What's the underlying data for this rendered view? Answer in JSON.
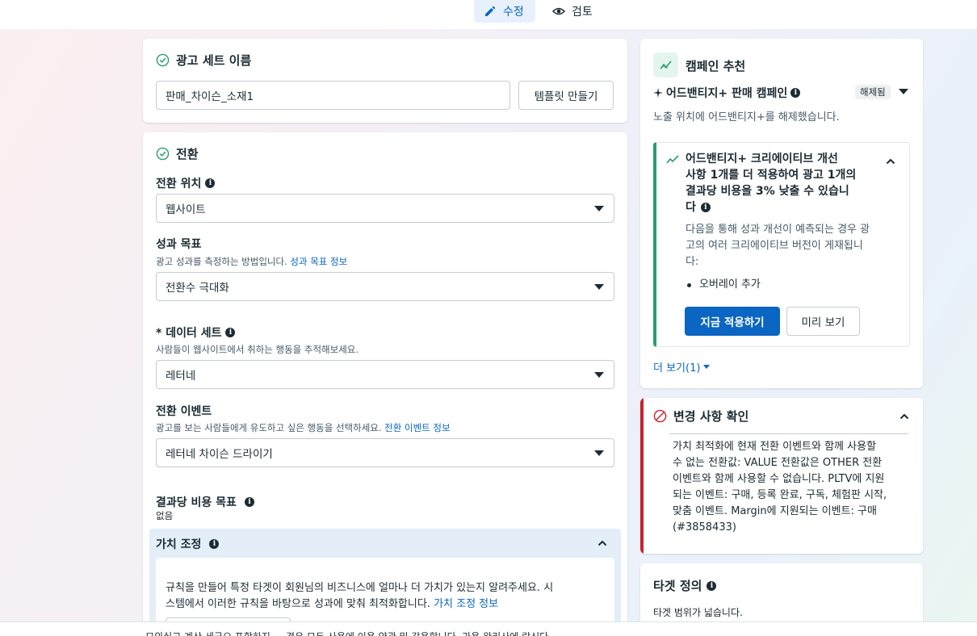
{
  "tabs": {
    "edit": "수정",
    "review": "검토"
  },
  "adset_name": {
    "title": "광고 세트 이름",
    "value": "판매_차이슨_소재1",
    "template_button": "템플릿 만들기"
  },
  "conversion": {
    "title": "전환",
    "location_label": "전환 위치",
    "location_value": "웹사이트",
    "goal_label": "성과 목표",
    "goal_desc": "광고 성과를 측정하는 방법입니다.",
    "goal_link": "성과 목표 정보",
    "goal_value": "전환수 극대화",
    "dataset_label": "* 데이터 세트",
    "dataset_desc": "사람들이 웹사이트에서 취하는 행동을 추적해보세요.",
    "dataset_value": "레터네",
    "event_label": "전환 이벤트",
    "event_desc": "광고를 보는 사람들에게 유도하고 싶은 행동을 선택하세요.",
    "event_link": "전환 이벤트 정보",
    "event_value": "레터네 차이슨 드라이기",
    "cost_label": "결과당 비용 목표",
    "cost_value": "없음",
    "value_adjust_title": "가치 조정",
    "value_adjust_desc_1": "규칙을 만들어 특정 타겟이 회원님의 비즈니스에 얼마나 더 가치가 있는지 알려주세요. 시",
    "value_adjust_desc_2": "스템에서 이러한 규칙을 바탕으로 성과에 맞춰 최적화합니다.",
    "value_adjust_link": "가치 조정 정보"
  },
  "campaign_rec": {
    "title": "캠페인 추천",
    "advantage_label": "어드밴티지+ 판매 캠페인",
    "badge": "해제됨",
    "desc": "노출 위치에 어드밴티지+를 해제했습니다.",
    "tip_title_1": "어드밴티지+ 크리에이티브 개선",
    "tip_title_2": "사항 1개를 더 적용하여 광고 1개의",
    "tip_title_3": "결과당 비용을 3% 낮출 수 있습니",
    "tip_title_4": "다",
    "tip_body_1": "다음을 통해 성과 개선이 예측되는 경우 광",
    "tip_body_2": "고의 여러 크리에이티브 버전이 게재됩니",
    "tip_body_3": "다:",
    "tip_bullet": "오버레이 추가",
    "apply_button": "지금 적용하기",
    "preview_button": "미리 보기",
    "more_link": "더 보기(1)"
  },
  "review_changes": {
    "title": "변경 사항 확인",
    "lines": [
      "가치 최적화에 현재 전환 이벤트와 함께 사용할",
      "수 없는 전환값: VALUE 전환값은 OTHER 전환",
      "이벤트와 함께 사용할 수 없습니다. PLTV에 지원",
      "되는 이벤트: 구매, 등록 완료, 구독, 체험판 시작,",
      "맞춤 이벤트. Margin에 지원되는 이벤트: 구매",
      "(#3858433)"
    ]
  },
  "target": {
    "title": "타겟 정의",
    "desc": "타겟 범위가 넓습니다."
  },
  "footer": {
    "text": "모의실고 계산 세금으 포함하지 ... 경우 모두 사용에 이용 약관 및 각용합니다. 가용 완리사에 랑신다"
  },
  "colors": {
    "accent": "#0a66c2",
    "error": "#c8222f",
    "success": "#2a9d6f"
  }
}
